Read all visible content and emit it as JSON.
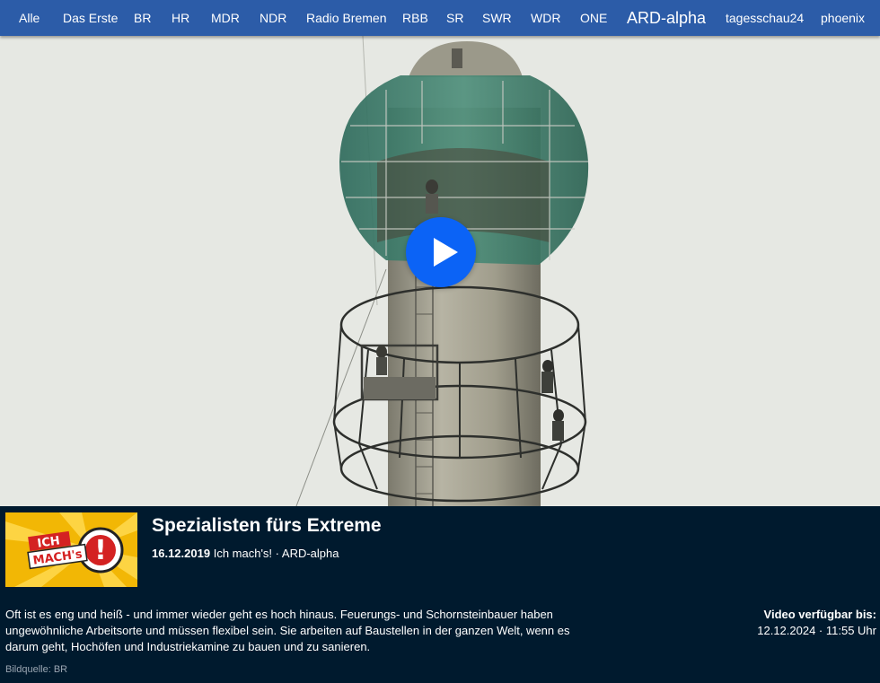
{
  "nav": {
    "items": [
      {
        "label": "Alle"
      },
      {
        "label": "Das Erste"
      },
      {
        "label": "BR"
      },
      {
        "label": "HR"
      },
      {
        "label": "MDR"
      },
      {
        "label": "NDR"
      },
      {
        "label": "Radio Bremen"
      },
      {
        "label": "RBB"
      },
      {
        "label": "SR"
      },
      {
        "label": "SWR"
      },
      {
        "label": "WDR"
      },
      {
        "label": "ONE"
      },
      {
        "label": "ARD-alpha"
      },
      {
        "label": "tagesschau24"
      },
      {
        "label": "phoenix"
      }
    ]
  },
  "player": {
    "play_icon": "play-icon",
    "accent": "#0b63f6"
  },
  "show": {
    "logo_text_1": "ICH",
    "logo_text_2": "MACH's",
    "logo_mark": "!"
  },
  "video": {
    "title": "Spezialisten fürs Extreme",
    "date": "16.12.2019",
    "series": "Ich mach's!",
    "channel": "· ARD-alpha",
    "description": "Oft ist es eng und heiß - und immer wieder geht es hoch hinaus. Feuerungs- und Schornsteinbauer haben ungewöhnliche Arbeitsorte und müssen flexibel sein. Sie arbeiten auf Baustellen in der ganzen Welt, wenn es darum geht, Hochöfen und Industriekamine zu bauen und zu sanieren.",
    "availability_label": "Video verfügbar bis:",
    "availability_value": "12.12.2024 · 11:55 Uhr",
    "credit": "Bildquelle: BR"
  },
  "colors": {
    "nav_bg": "#2c5ca8",
    "info_bg": "#001a2e"
  }
}
